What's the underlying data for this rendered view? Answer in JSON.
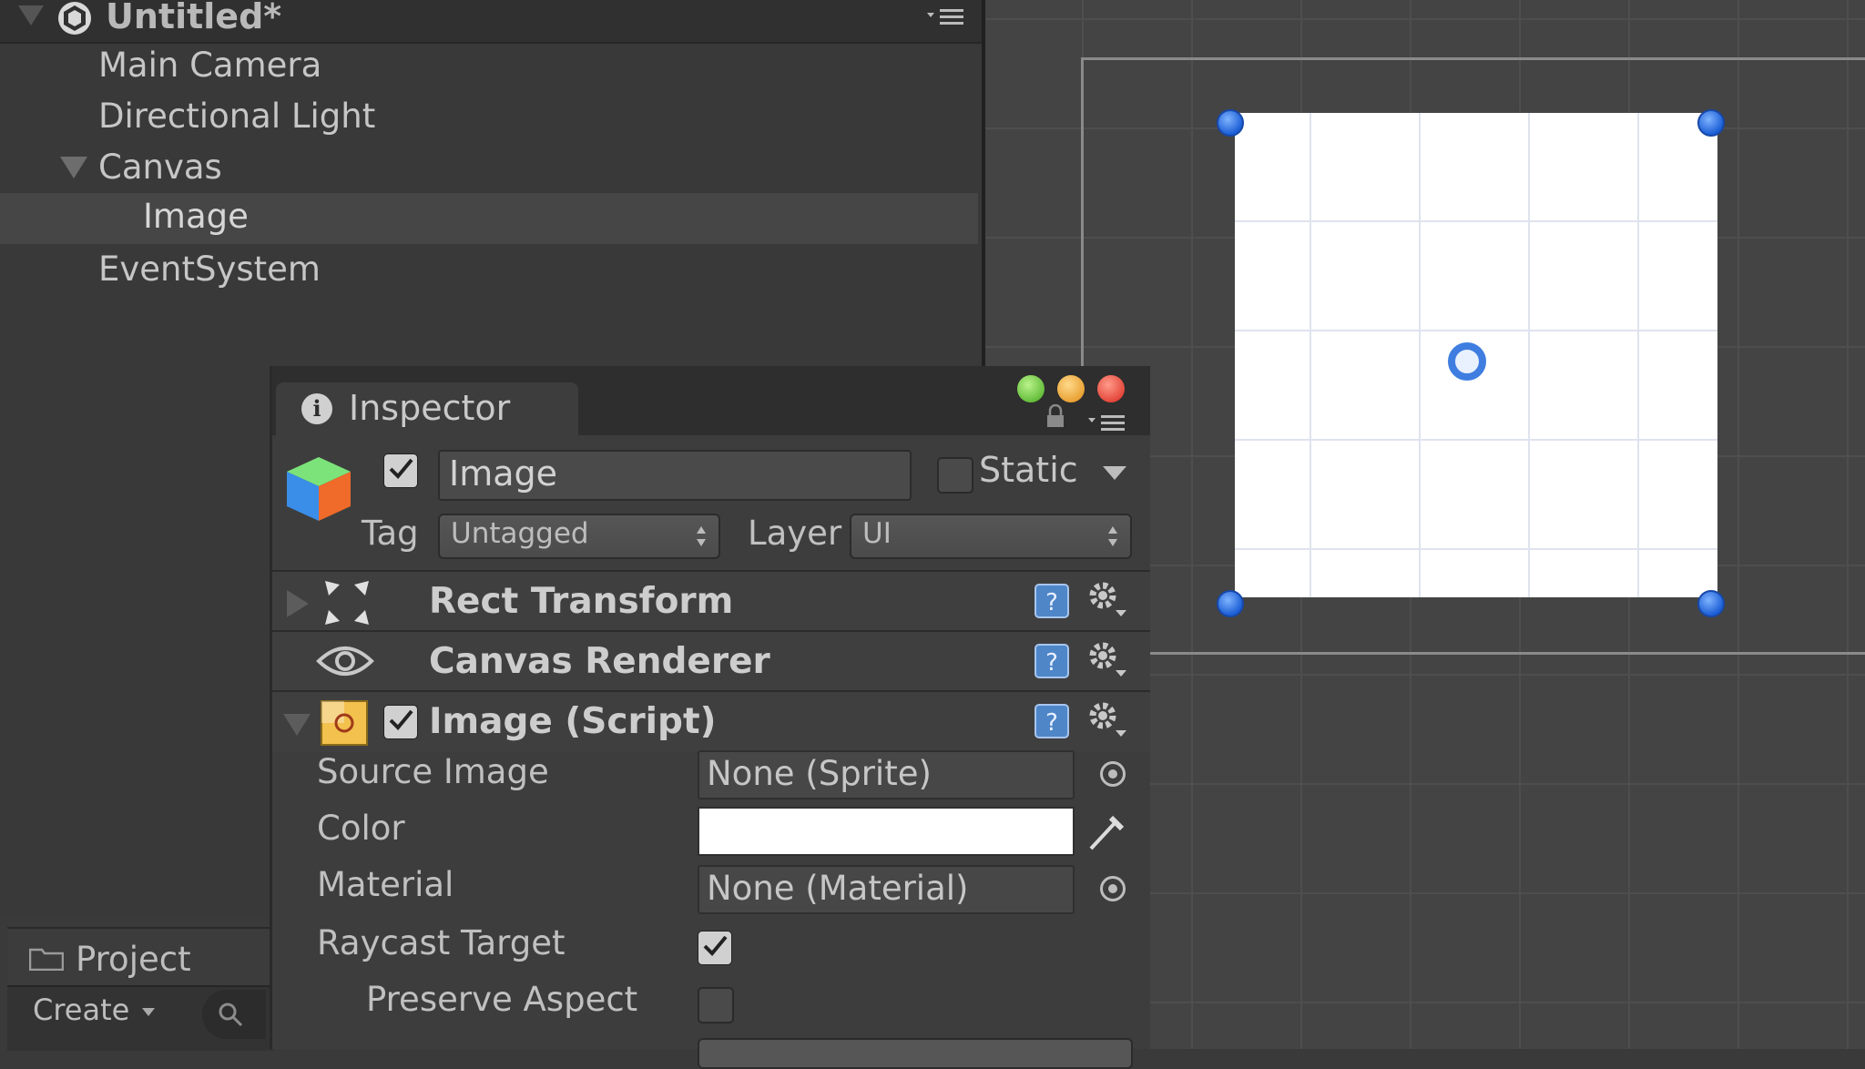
{
  "hierarchy": {
    "scene_title": "Untitled*",
    "items": [
      {
        "label": "Main Camera"
      },
      {
        "label": "Directional Light"
      },
      {
        "label": "Canvas"
      },
      {
        "label": "Image"
      },
      {
        "label": "EventSystem"
      }
    ],
    "selected": "Image"
  },
  "project": {
    "tab_label": "Project",
    "create_label": "Create"
  },
  "inspector": {
    "tab_label": "Inspector",
    "object": {
      "active": true,
      "name": "Image",
      "static_label": "Static",
      "static": false,
      "tag_label": "Tag",
      "tag_value": "Untagged",
      "layer_label": "Layer",
      "layer_value": "UI"
    },
    "components": [
      {
        "title": "Rect Transform",
        "expanded": false
      },
      {
        "title": "Canvas Renderer",
        "expanded": false
      },
      {
        "title": "Image (Script)",
        "expanded": true,
        "enabled": true
      }
    ],
    "image_script": {
      "source_image_label": "Source Image",
      "source_image_value": "None (Sprite)",
      "color_label": "Color",
      "color_value": "#FFFFFF",
      "material_label": "Material",
      "material_value": "None (Material)",
      "raycast_label": "Raycast Target",
      "raycast_value": true,
      "preserve_label": "Preserve Aspect",
      "preserve_value": false
    }
  },
  "colors": {
    "panel_bg": "#393939",
    "selection": "#464646",
    "handle_blue": "#1d5fd6",
    "image_white": "#FFFFFF"
  },
  "icons": [
    "unity-logo-icon",
    "hierarchy-menu-icon",
    "info-icon",
    "lock-icon",
    "tab-menu-icon",
    "gameobject-cube-icon",
    "rect-transform-icon",
    "eye-icon",
    "image-component-icon",
    "help-icon",
    "gear-icon",
    "object-picker-icon",
    "eyedropper-icon",
    "folder-icon",
    "search-icon"
  ]
}
